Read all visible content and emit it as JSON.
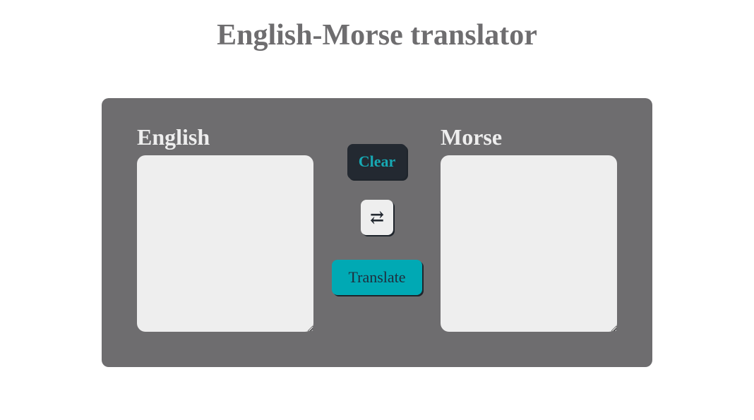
{
  "title": "English-Morse translator",
  "english": {
    "label": "English",
    "value": ""
  },
  "morse": {
    "label": "Morse",
    "value": ""
  },
  "buttons": {
    "clear": "Clear",
    "swap_icon": "⇄",
    "translate": "Translate"
  },
  "colors": {
    "panel": "#6e6d6f",
    "accent": "#00a9b4",
    "dark": "#232931",
    "field": "#eeeeee"
  }
}
